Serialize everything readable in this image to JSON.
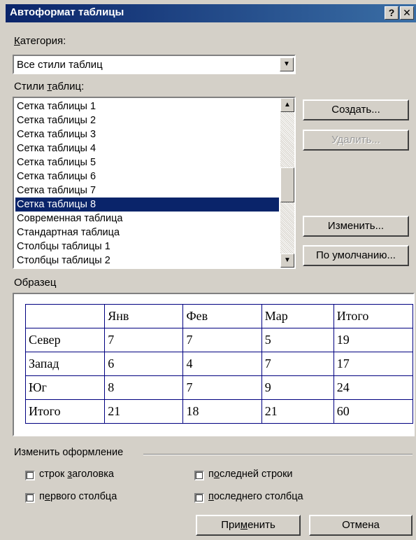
{
  "window": {
    "title": "Автоформат таблицы",
    "help_button": "?",
    "close_button": "✕"
  },
  "category": {
    "label": "Категория:",
    "selected": "Все стили таблиц"
  },
  "styles": {
    "label": "Стили таблиц:",
    "items": [
      "Сетка таблицы 1",
      "Сетка таблицы 2",
      "Сетка таблицы 3",
      "Сетка таблицы 4",
      "Сетка таблицы 5",
      "Сетка таблицы 6",
      "Сетка таблицы 7",
      "Сетка таблицы 8",
      "Современная таблица",
      "Стандартная таблица",
      "Столбцы таблицы 1",
      "Столбцы таблицы 2"
    ],
    "selected_index": 7
  },
  "buttons": {
    "create": "Создать...",
    "delete": "Удалить...",
    "modify": "Изменить...",
    "default": "По умолчанию...",
    "apply": "Применить",
    "cancel": "Отмена"
  },
  "preview": {
    "label": "Образец",
    "header": [
      "",
      "Янв",
      "Фев",
      "Мар",
      "Итого"
    ],
    "rows": [
      [
        "Север",
        "7",
        "7",
        "5",
        "19"
      ],
      [
        "Запад",
        "6",
        "4",
        "7",
        "17"
      ],
      [
        "Юг",
        "8",
        "7",
        "9",
        "24"
      ],
      [
        "Итого",
        "21",
        "18",
        "21",
        "60"
      ]
    ]
  },
  "apply_options": {
    "label": "Изменить оформление",
    "header_rows": "строк заголовка",
    "first_column": "первого столбца",
    "last_row": "последней строки",
    "last_column": "последнего столбца"
  },
  "colors": {
    "title_start": "#0a246a",
    "title_end": "#3a6ea5",
    "selection": "#0a246a",
    "face": "#d4d0c8",
    "table_border": "#000080"
  }
}
